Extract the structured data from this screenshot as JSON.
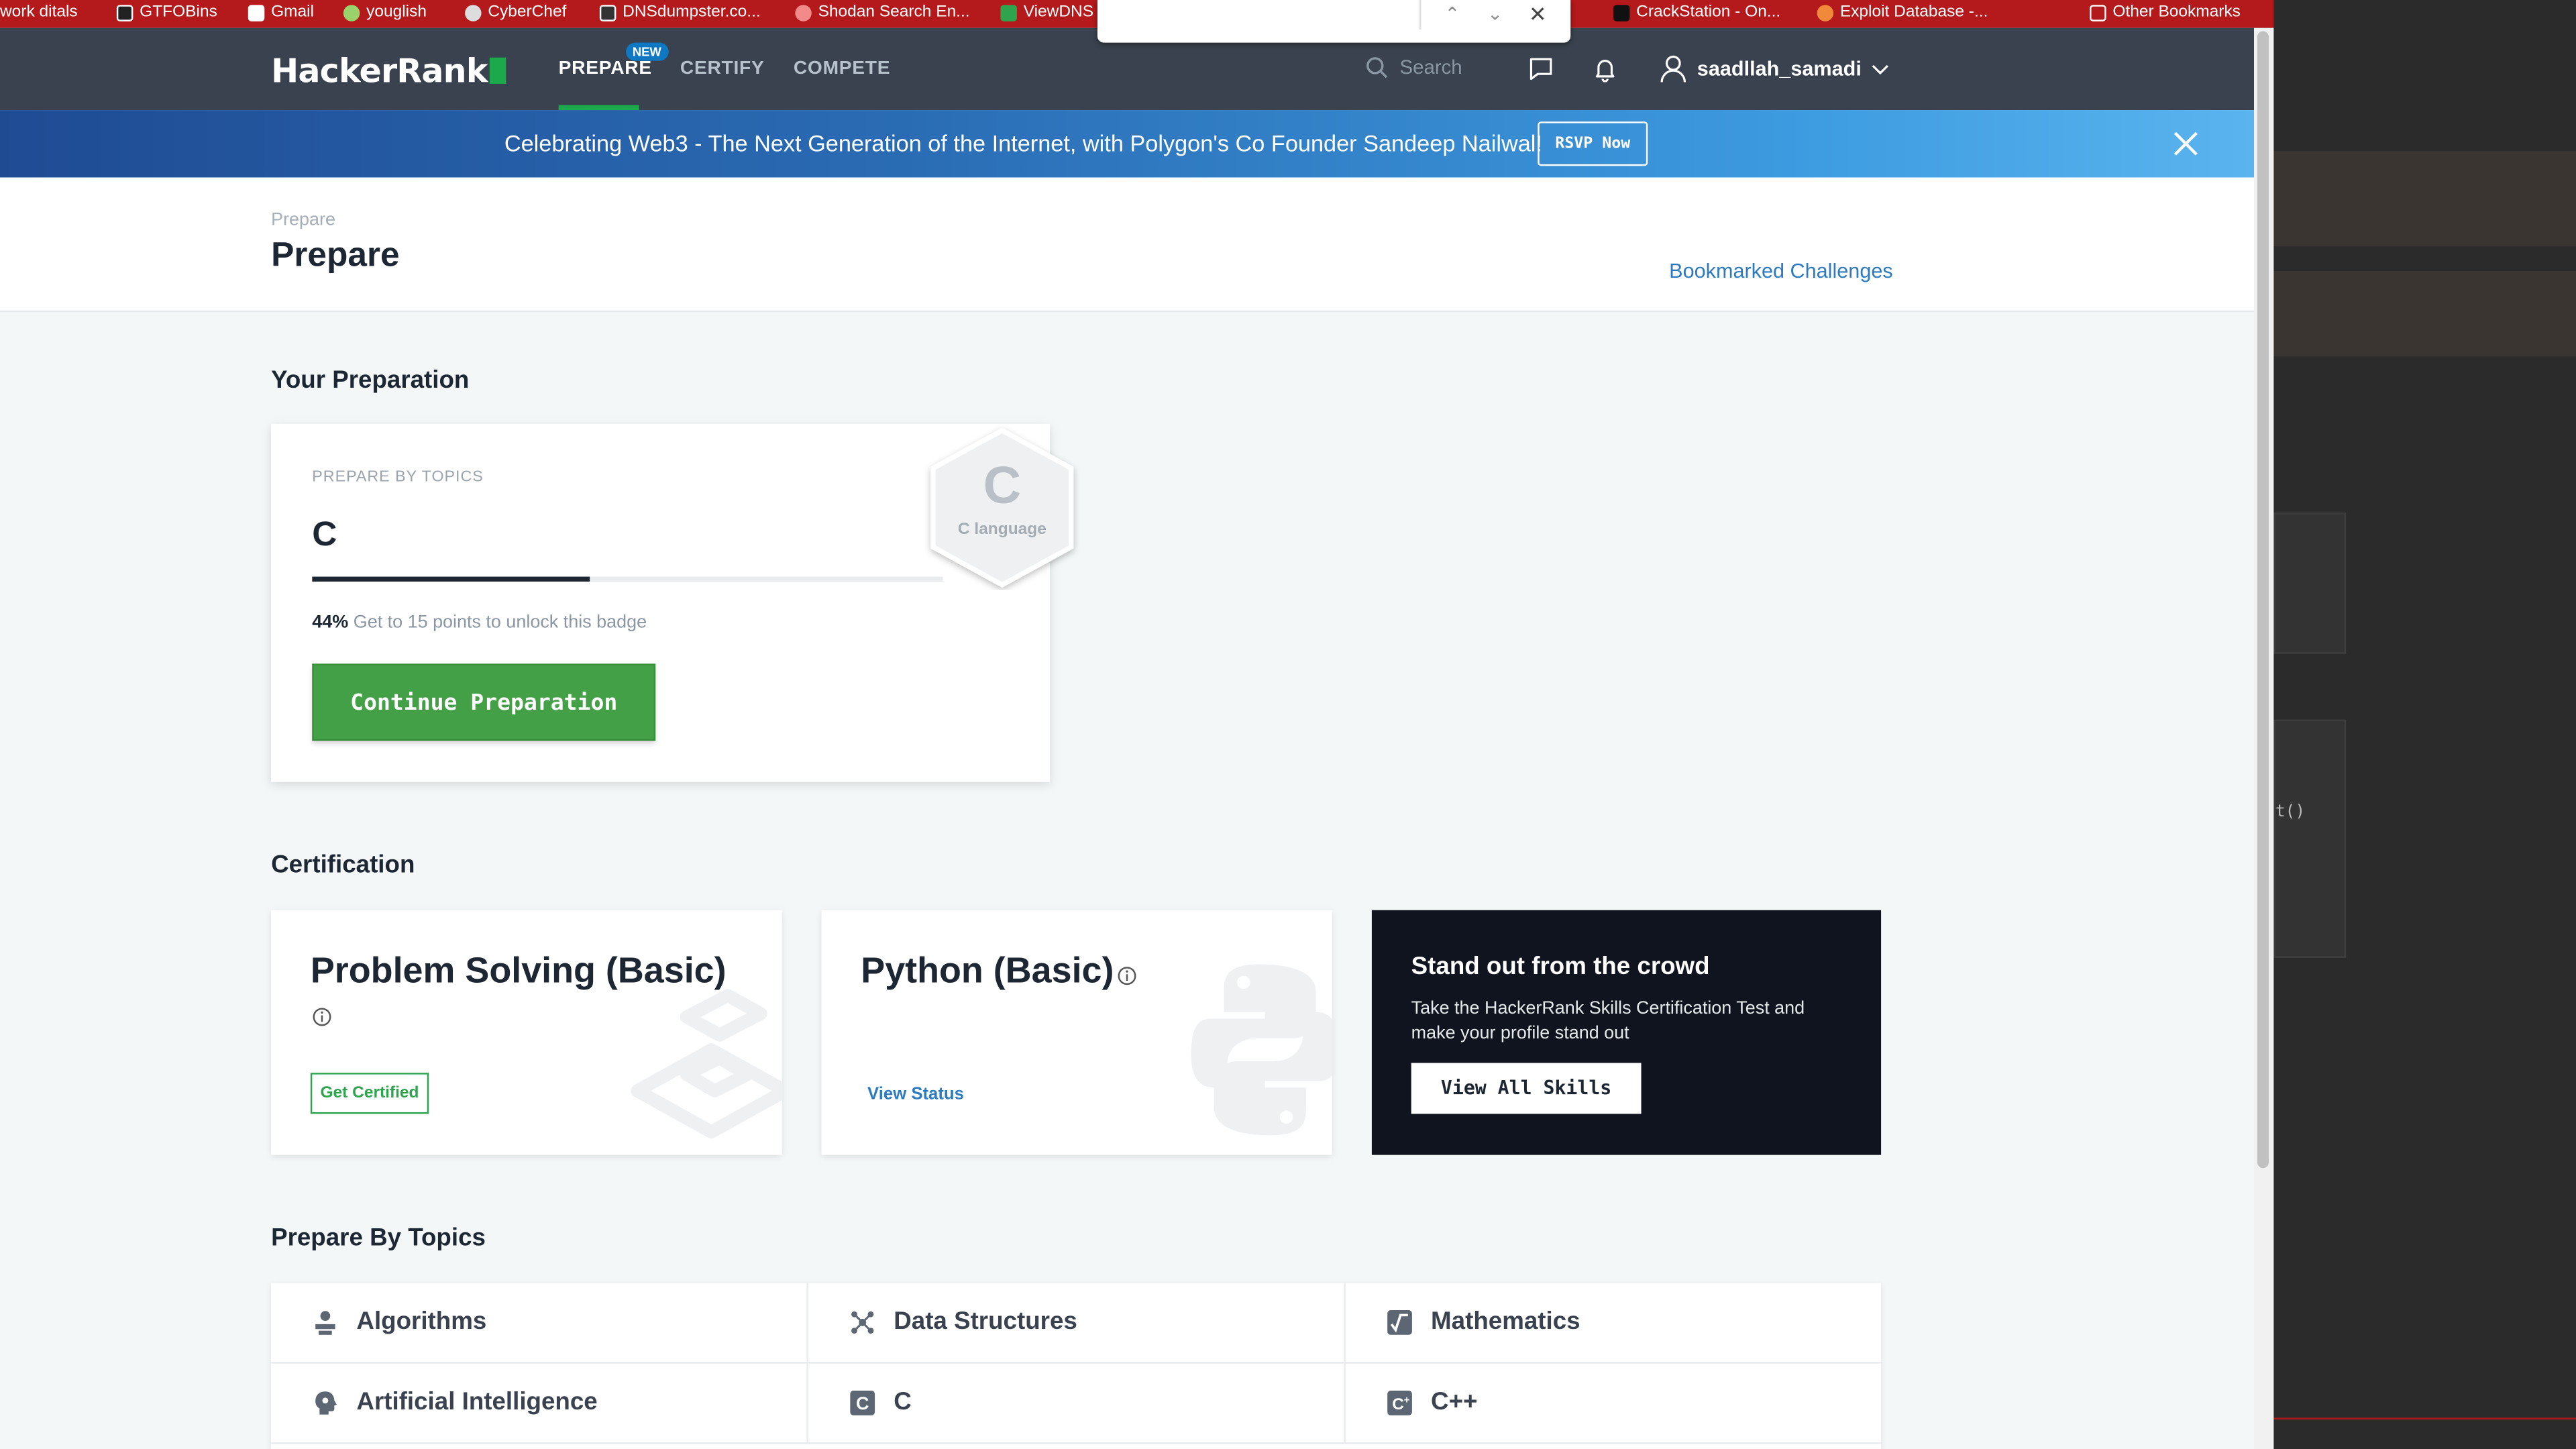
{
  "bookmarks_bar": {
    "items": [
      "work ditals",
      "GTFOBins",
      "Gmail",
      "youglish",
      "CyberChef",
      "DNSdumpster.co...",
      "Shodan Search En...",
      "ViewDNS",
      "CrackStation - On...",
      "Exploit Database -...",
      "Other Bookmarks"
    ]
  },
  "navbar": {
    "logo": "HackerRank",
    "tabs": [
      {
        "label": "PREPARE",
        "active": true
      },
      {
        "label": "CERTIFY",
        "active": false
      },
      {
        "label": "COMPETE",
        "active": false
      }
    ],
    "new_badge": "NEW",
    "search_placeholder": "Search",
    "username": "saadllah_samadi"
  },
  "banner": {
    "text": "Celebrating Web3 - The Next Generation of the Internet, with Polygon's Co Founder Sandeep Nailwal!",
    "button": "RSVP Now"
  },
  "header": {
    "breadcrumb": "Prepare",
    "title": "Prepare",
    "bookmarked_link": "Bookmarked Challenges"
  },
  "your_preparation": {
    "section_title": "Your Preparation",
    "label": "PREPARE BY TOPICS",
    "topic": "C",
    "progress_percent": 44,
    "progress_text_percent": "44%",
    "progress_text": "Get to 15 points to unlock this badge",
    "button": "Continue Preparation",
    "badge_letter": "C",
    "badge_label": "C language"
  },
  "certification": {
    "section_title": "Certification",
    "cards": [
      {
        "title": "Problem Solving (Basic)",
        "action": "Get Certified"
      },
      {
        "title": "Python (Basic)",
        "action": "View Status"
      }
    ],
    "promo": {
      "title": "Stand out from the crowd",
      "text": "Take the HackerRank Skills Certification Test and make your profile stand out",
      "button": "View All Skills"
    }
  },
  "prepare_by_topics": {
    "section_title": "Prepare By Topics",
    "items": [
      {
        "label": "Algorithms",
        "icon": "algorithms-icon"
      },
      {
        "label": "Data Structures",
        "icon": "data-structures-icon"
      },
      {
        "label": "Mathematics",
        "icon": "mathematics-icon"
      },
      {
        "label": "Artificial Intelligence",
        "icon": "ai-icon"
      },
      {
        "label": "C",
        "icon": "c-icon"
      },
      {
        "label": "C++",
        "icon": "cpp-icon"
      }
    ]
  },
  "right_pane": {
    "code_fragment": "t()"
  },
  "colors": {
    "bookmark_bar": "#b4191b",
    "nav_bg": "#39424e",
    "brand_green": "#1ba94c",
    "link_blue": "#2c7ac0",
    "promo_bg": "#0f141e"
  }
}
